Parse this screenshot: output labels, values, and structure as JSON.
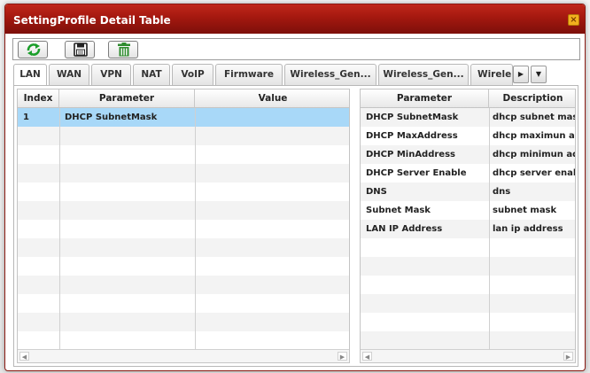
{
  "dialog": {
    "title": "SettingProfile Detail Table",
    "close_label": "×"
  },
  "toolbar": {
    "buttons": [
      {
        "name": "refresh-icon"
      },
      {
        "name": "save-icon"
      },
      {
        "name": "delete-icon"
      }
    ]
  },
  "tabs": [
    {
      "label": "LAN",
      "active": true
    },
    {
      "label": "WAN"
    },
    {
      "label": "VPN"
    },
    {
      "label": "NAT"
    },
    {
      "label": "VoIP"
    },
    {
      "label": "Firmware"
    },
    {
      "label": "Wireless_Gen..."
    },
    {
      "label": "Wireless_Gen..."
    },
    {
      "label": "Wirele"
    }
  ],
  "tab_scroll": {
    "next": "▶",
    "menu": "▼"
  },
  "left_grid": {
    "headers": {
      "index": "Index",
      "parameter": "Parameter",
      "value": "Value"
    },
    "rows": [
      {
        "index": "1",
        "parameter": "DHCP SubnetMask",
        "value": ""
      }
    ]
  },
  "right_grid": {
    "headers": {
      "parameter": "Parameter",
      "description": "Description"
    },
    "rows": [
      {
        "parameter": "DHCP SubnetMask",
        "description": "dhcp subnet mask"
      },
      {
        "parameter": "DHCP MaxAddress",
        "description": "dhcp maximun address"
      },
      {
        "parameter": "DHCP MinAddress",
        "description": "dhcp minimun address"
      },
      {
        "parameter": "DHCP Server Enable",
        "description": "dhcp server enable"
      },
      {
        "parameter": "DNS",
        "description": "dns"
      },
      {
        "parameter": "Subnet Mask",
        "description": "subnet mask"
      },
      {
        "parameter": "LAN IP Address",
        "description": "lan ip address"
      }
    ]
  },
  "scroll": {
    "left": "◀",
    "right": "▶"
  },
  "colors": {
    "title_bar": "#a3180f",
    "selected_row": "#a8d8f8",
    "refresh_green": "#1a9e2a",
    "delete_green": "#2e8b2e"
  }
}
